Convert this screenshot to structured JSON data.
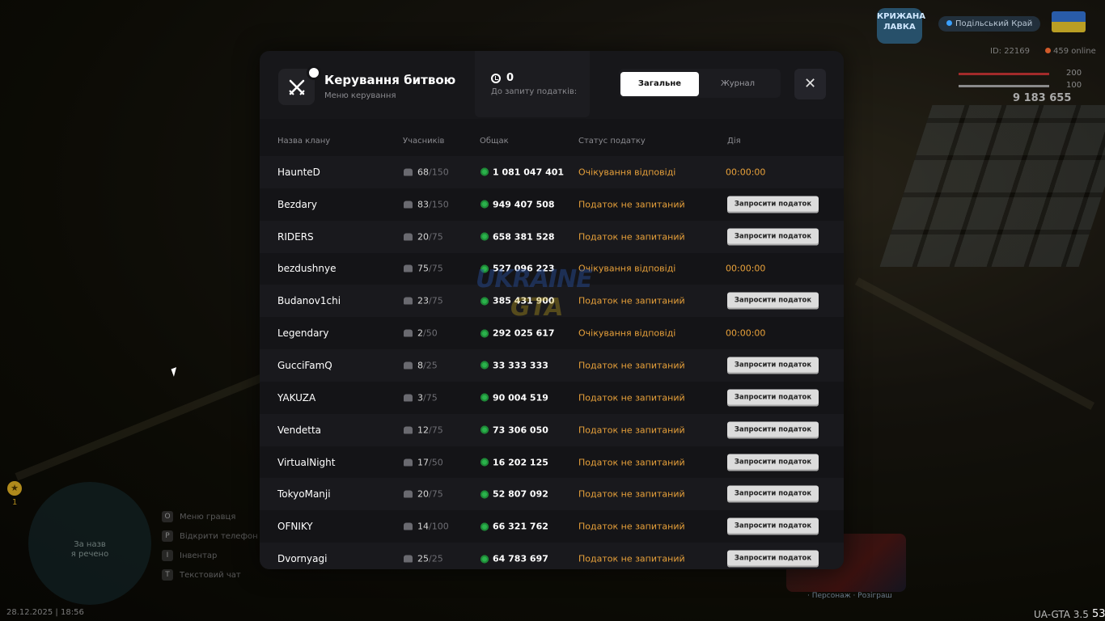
{
  "hud": {
    "logo_text": "КРИЖАНА ЛАВКА",
    "server_name": "Подільський Край",
    "player_id": "ID: 22169",
    "online": "459 online",
    "health_value": "200",
    "armor_value": "100",
    "money": "9 183 655",
    "minimap_text_1": "За назв",
    "minimap_text_2": "я речено",
    "star_count": "1",
    "hints": [
      {
        "key": "O",
        "label": "Меню гравця"
      },
      {
        "key": "P",
        "label": "Відкрити телефон"
      },
      {
        "key": "I",
        "label": "Інвентар"
      },
      {
        "key": "T",
        "label": "Текстовий чат"
      }
    ],
    "datetime": "28.12.2025 | 18:56",
    "version": "UA-GTA 3.5",
    "fps": "53",
    "giveaway_text": "· Персонаж · Розіграш"
  },
  "modal": {
    "title": "Керування битвою",
    "subtitle": "Меню керування",
    "counter_value": "0",
    "counter_label": "До запиту податків:",
    "tab_general": "Загальне",
    "tab_journal": "Журнал",
    "close_symbol": "✕"
  },
  "table": {
    "headers": {
      "name": "Назва клану",
      "members": "Учасників",
      "fund": "Общак",
      "status": "Статус податку",
      "action": "Дія"
    },
    "rows": [
      {
        "name": "HaunteD",
        "members": "68",
        "max": "/150",
        "fund": "1 081 047 401",
        "status": "Очікування відповіді",
        "action_type": "time",
        "action": "00:00:00"
      },
      {
        "name": "Bezdary",
        "members": "83",
        "max": "/150",
        "fund": "949 407 508",
        "status": "Податок не запитаний",
        "action_type": "button",
        "action": "Запросити податок"
      },
      {
        "name": "RIDERS",
        "members": "20",
        "max": "/75",
        "fund": "658 381 528",
        "status": "Податок не запитаний",
        "action_type": "button",
        "action": "Запросити податок"
      },
      {
        "name": "bezdushnye",
        "members": "75",
        "max": "/75",
        "fund": "527 096 223",
        "status": "Очікування відповіді",
        "action_type": "time",
        "action": "00:00:00"
      },
      {
        "name": "Budanov1chi",
        "members": "23",
        "max": "/75",
        "fund": "385 431 900",
        "status": "Податок не запитаний",
        "action_type": "button",
        "action": "Запросити податок"
      },
      {
        "name": "Legendary",
        "members": "2",
        "max": "/50",
        "fund": "292 025 617",
        "status": "Очікування відповіді",
        "action_type": "time",
        "action": "00:00:00"
      },
      {
        "name": "GucciFamQ",
        "members": "8",
        "max": "/25",
        "fund": "33 333 333",
        "status": "Податок не запитаний",
        "action_type": "button",
        "action": "Запросити податок"
      },
      {
        "name": "YAKUZA",
        "members": "3",
        "max": "/75",
        "fund": "90 004 519",
        "status": "Податок не запитаний",
        "action_type": "button",
        "action": "Запросити податок"
      },
      {
        "name": "Vendetta",
        "members": "12",
        "max": "/75",
        "fund": "73 306 050",
        "status": "Податок не запитаний",
        "action_type": "button",
        "action": "Запросити податок"
      },
      {
        "name": "VirtualNight",
        "members": "17",
        "max": "/50",
        "fund": "16 202 125",
        "status": "Податок не запитаний",
        "action_type": "button",
        "action": "Запросити податок"
      },
      {
        "name": "TokyoManji",
        "members": "20",
        "max": "/75",
        "fund": "52 807 092",
        "status": "Податок не запитаний",
        "action_type": "button",
        "action": "Запросити податок"
      },
      {
        "name": "OFNIKY",
        "members": "14",
        "max": "/100",
        "fund": "66 321 762",
        "status": "Податок не запитаний",
        "action_type": "button",
        "action": "Запросити податок"
      },
      {
        "name": "Dvornyagi",
        "members": "25",
        "max": "/25",
        "fund": "64 783 697",
        "status": "Податок не запитаний",
        "action_type": "button",
        "action": "Запросити податок"
      }
    ]
  },
  "watermark": {
    "line1": "UKRAINE",
    "line2": "GTA"
  }
}
